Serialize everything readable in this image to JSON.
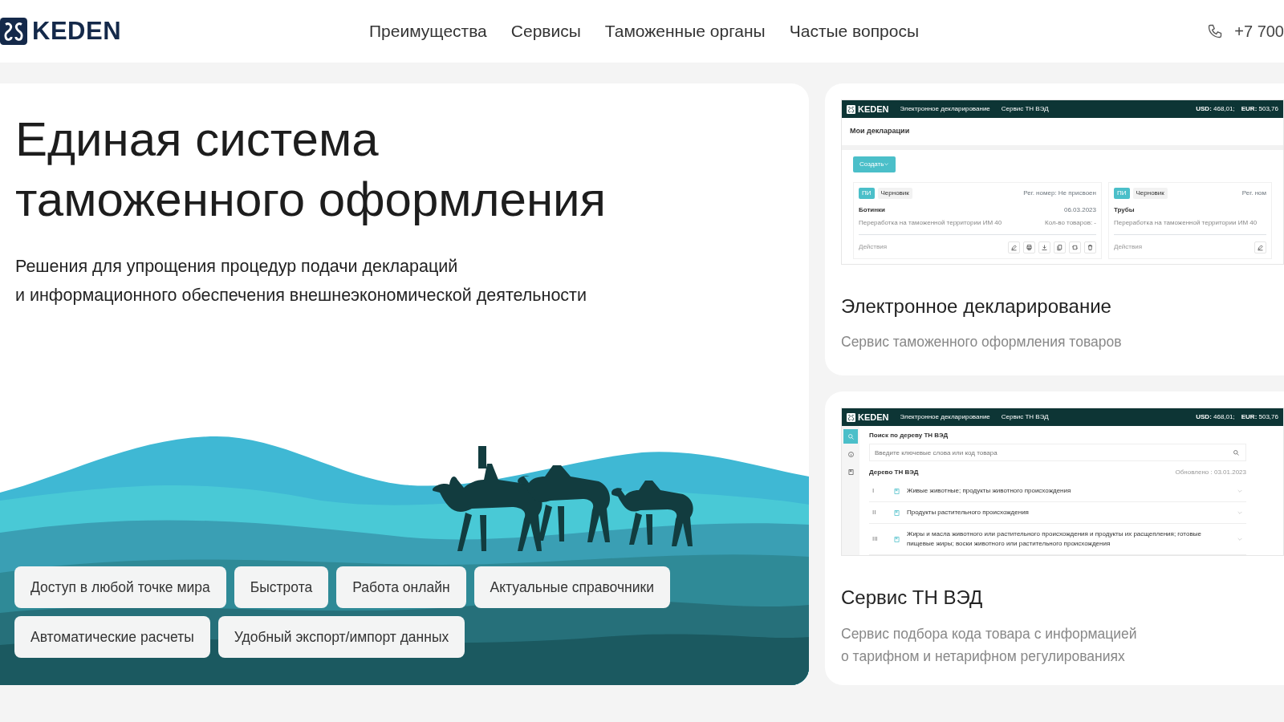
{
  "header": {
    "logo": "KEDEN",
    "nav": [
      {
        "label": "Преимущества"
      },
      {
        "label": "Сервисы"
      },
      {
        "label": "Таможенные органы"
      },
      {
        "label": "Частые вопросы"
      }
    ],
    "phone": "+7 700"
  },
  "hero": {
    "title_lines": [
      "Единая система",
      "таможенного оформления"
    ],
    "subtitle_lines": [
      "Решения для упрощения процедур подачи деклараций",
      "и информационного обеспечения внешнеэкономической деятельности"
    ],
    "features": [
      "Доступ в любой точке мира",
      "Быстрота",
      "Работа онлайн",
      "Актуальные справочники",
      "Автоматические расчеты",
      "Удобный экспорт/импорт данных"
    ]
  },
  "services": [
    {
      "kind": "declarations",
      "title": "Электронное декларирование",
      "description_lines": [
        "Сервис таможенного оформления товаров"
      ],
      "preview": {
        "logo": "KEDEN",
        "nav": [
          "Электронное декларирование",
          "Сервис ТН ВЭД"
        ],
        "rates": [
          {
            "label": "USD:",
            "value": "468,01;"
          },
          {
            "label": "EUR:",
            "value": "503,76"
          }
        ],
        "page_title": "Мои декларации",
        "create_button": "Создать",
        "cards": [
          {
            "type": "ПИ",
            "status": "Черновик",
            "reg": "Рег. номер: Не присвоен",
            "name": "Ботинки",
            "date": "06.03.2023",
            "procedure": "Переработка на таможенной территории  ИМ  40",
            "count": "Кол-во товаров: -",
            "actions_label": "Действия",
            "actions": [
              {
                "kind": "pencil"
              },
              {
                "kind": "printer"
              },
              {
                "kind": "download"
              },
              {
                "kind": "copy"
              },
              {
                "kind": "frame"
              },
              {
                "kind": "trash"
              }
            ]
          },
          {
            "type": "ПИ",
            "status": "Черновик",
            "reg": "Рег. ном",
            "name": "Трубы",
            "procedure": "Переработка на таможенной территории  ИМ  40",
            "actions_label": "Действия",
            "actions": [
              {
                "kind": "pencil"
              }
            ]
          }
        ]
      }
    },
    {
      "kind": "tnved",
      "title": "Сервис ТН ВЭД",
      "description_lines": [
        "Сервис подбора кода товара с информацией",
        "о тарифном и нетарифном регулированиях"
      ],
      "preview": {
        "logo": "KEDEN",
        "nav": [
          "Электронное декларирование",
          "Сервис ТН ВЭД"
        ],
        "rates": [
          {
            "label": "USD:",
            "value": "468,01;"
          },
          {
            "label": "EUR:",
            "value": "503,76"
          }
        ],
        "sidebar": [
          {
            "selected": true
          },
          {
            "selected": false
          },
          {
            "selected": false
          }
        ],
        "search_title": "Поиск по дереву ТН ВЭД",
        "search_placeholder": "Введите ключевые слова или код товара",
        "tree_title": "Дерево ТН ВЭД",
        "updated": "Обновлено : 03.01.2023",
        "rows": [
          {
            "num": "I",
            "text": "Живые животные; продукты животного происхождения"
          },
          {
            "num": "II",
            "text": "Продукты растительного происхождения"
          },
          {
            "num": "III",
            "text": "Жиры и масла животного или растительного происхождения и продукты их расщепления; готовые пищевые жиры; воски животного или растительного происхождения"
          }
        ]
      }
    }
  ]
}
